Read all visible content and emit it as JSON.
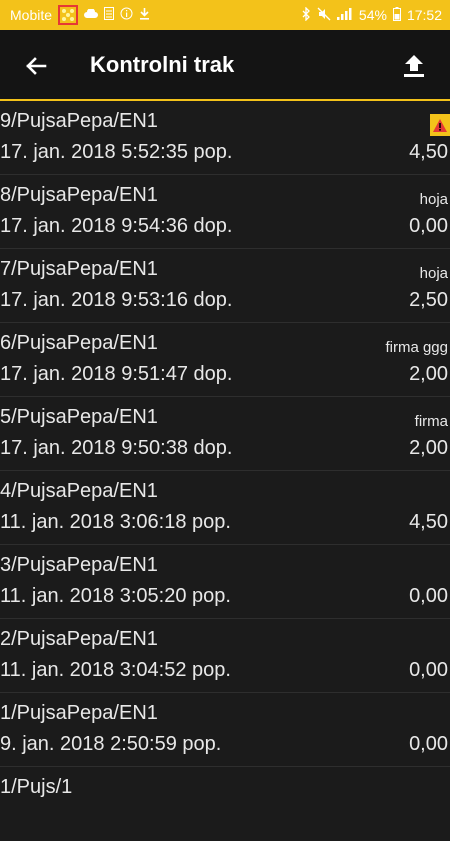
{
  "status_bar": {
    "carrier": "Mobite",
    "battery": "54%",
    "time": "17:52"
  },
  "app_bar": {
    "title": "Kontrolni trak",
    "back_icon": "arrow-left-icon",
    "export_icon": "upload-icon"
  },
  "colors": {
    "accent": "#f3c21a",
    "background": "#1b1b1b",
    "warning": "#e53935"
  },
  "entries": [
    {
      "id": "9/PujsaPepa/EN1",
      "date": "17. jan. 2018 5:52:35 pop.",
      "note": "",
      "amount": "4,50",
      "warning": true
    },
    {
      "id": "8/PujsaPepa/EN1",
      "date": "17. jan. 2018 9:54:36 dop.",
      "note": "hoja",
      "amount": "0,00",
      "warning": false
    },
    {
      "id": "7/PujsaPepa/EN1",
      "date": "17. jan. 2018 9:53:16 dop.",
      "note": "hoja",
      "amount": "2,50",
      "warning": false
    },
    {
      "id": "6/PujsaPepa/EN1",
      "date": "17. jan. 2018 9:51:47 dop.",
      "note": "firma ggg",
      "amount": "2,00",
      "warning": false
    },
    {
      "id": "5/PujsaPepa/EN1",
      "date": "17. jan. 2018 9:50:38 dop.",
      "note": "firma",
      "amount": "2,00",
      "warning": false
    },
    {
      "id": "4/PujsaPepa/EN1",
      "date": "11. jan. 2018 3:06:18 pop.",
      "note": "",
      "amount": "4,50",
      "warning": false
    },
    {
      "id": "3/PujsaPepa/EN1",
      "date": "11. jan. 2018 3:05:20 pop.",
      "note": "",
      "amount": "0,00",
      "warning": false
    },
    {
      "id": "2/PujsaPepa/EN1",
      "date": "11. jan. 2018 3:04:52 pop.",
      "note": "",
      "amount": "0,00",
      "warning": false
    },
    {
      "id": "1/PujsaPepa/EN1",
      "date": "9. jan. 2018 2:50:59 pop.",
      "note": "",
      "amount": "0,00",
      "warning": false
    },
    {
      "id": "1/Pujs/1",
      "date": "",
      "note": "",
      "amount": "",
      "warning": false
    }
  ]
}
